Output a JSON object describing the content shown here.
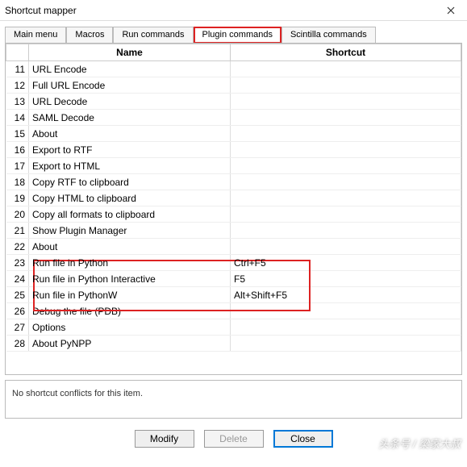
{
  "window": {
    "title": "Shortcut mapper"
  },
  "tabs": {
    "items": [
      {
        "label": "Main menu",
        "active": false
      },
      {
        "label": "Macros",
        "active": false
      },
      {
        "label": "Run commands",
        "active": false
      },
      {
        "label": "Plugin commands",
        "active": true,
        "highlighted": true
      },
      {
        "label": "Scintilla commands",
        "active": false
      }
    ]
  },
  "table": {
    "headers": {
      "name": "Name",
      "shortcut": "Shortcut"
    },
    "rows": [
      {
        "num": "11",
        "name": "URL Encode",
        "shortcut": ""
      },
      {
        "num": "12",
        "name": "Full URL Encode",
        "shortcut": ""
      },
      {
        "num": "13",
        "name": "URL Decode",
        "shortcut": ""
      },
      {
        "num": "14",
        "name": "SAML Decode",
        "shortcut": ""
      },
      {
        "num": "15",
        "name": "About",
        "shortcut": ""
      },
      {
        "num": "16",
        "name": "Export to RTF",
        "shortcut": ""
      },
      {
        "num": "17",
        "name": "Export to HTML",
        "shortcut": ""
      },
      {
        "num": "18",
        "name": "Copy RTF to clipboard",
        "shortcut": ""
      },
      {
        "num": "19",
        "name": "Copy HTML to clipboard",
        "shortcut": ""
      },
      {
        "num": "20",
        "name": "Copy all formats to clipboard",
        "shortcut": ""
      },
      {
        "num": "21",
        "name": "Show Plugin Manager",
        "shortcut": ""
      },
      {
        "num": "22",
        "name": "About",
        "shortcut": ""
      },
      {
        "num": "23",
        "name": "Run file in Python",
        "shortcut": "Ctrl+F5",
        "hl": true
      },
      {
        "num": "24",
        "name": "Run file in Python Interactive",
        "shortcut": "F5",
        "hl": true
      },
      {
        "num": "25",
        "name": "Run file in PythonW",
        "shortcut": "Alt+Shift+F5",
        "hl": true
      },
      {
        "num": "26",
        "name": "Debug the file (PDB)",
        "shortcut": ""
      },
      {
        "num": "27",
        "name": "Options",
        "shortcut": ""
      },
      {
        "num": "28",
        "name": "About PyNPP",
        "shortcut": ""
      }
    ]
  },
  "conflicts": {
    "message": "No shortcut conflicts for this item."
  },
  "buttons": {
    "modify": "Modify",
    "delete": "Delete",
    "close": "Close"
  },
  "watermark": "头条号 / 梁家大叔"
}
